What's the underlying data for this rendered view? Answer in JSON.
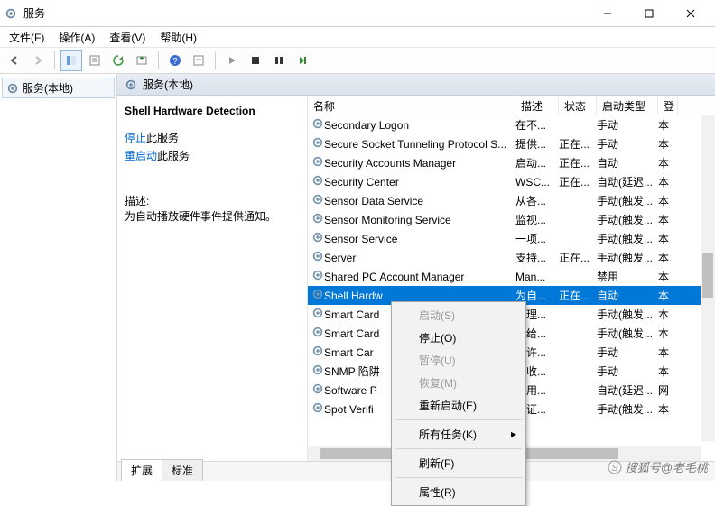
{
  "window": {
    "title": "服务"
  },
  "menu": {
    "file": "文件(F)",
    "action": "操作(A)",
    "view": "查看(V)",
    "help": "帮助(H)"
  },
  "tree": {
    "root": "服务(本地)"
  },
  "right_header": {
    "label": "服务(本地)"
  },
  "detail": {
    "title": "Shell Hardware Detection",
    "stop_link": "停止",
    "stop_suffix": "此服务",
    "restart_link": "重启动",
    "restart_suffix": "此服务",
    "desc_label": "描述:",
    "desc": "为自动播放硬件事件提供通知。"
  },
  "columns": {
    "name": "名称",
    "desc": "描述",
    "status": "状态",
    "startup": "启动类型",
    "logon": "登"
  },
  "services": [
    {
      "name": "Secondary Logon",
      "desc": "在不...",
      "status": "",
      "startup": "手动",
      "logon": "本"
    },
    {
      "name": "Secure Socket Tunneling Protocol S...",
      "desc": "提供...",
      "status": "正在...",
      "startup": "手动",
      "logon": "本"
    },
    {
      "name": "Security Accounts Manager",
      "desc": "启动...",
      "status": "正在...",
      "startup": "自动",
      "logon": "本"
    },
    {
      "name": "Security Center",
      "desc": "WSC...",
      "status": "正在...",
      "startup": "自动(延迟...",
      "logon": "本"
    },
    {
      "name": "Sensor Data Service",
      "desc": "从各...",
      "status": "",
      "startup": "手动(触发...",
      "logon": "本"
    },
    {
      "name": "Sensor Monitoring Service",
      "desc": "监视...",
      "status": "",
      "startup": "手动(触发...",
      "logon": "本"
    },
    {
      "name": "Sensor Service",
      "desc": "一项...",
      "status": "",
      "startup": "手动(触发...",
      "logon": "本"
    },
    {
      "name": "Server",
      "desc": "支持...",
      "status": "正在...",
      "startup": "手动(触发...",
      "logon": "本"
    },
    {
      "name": "Shared PC Account Manager",
      "desc": "Man...",
      "status": "",
      "startup": "禁用",
      "logon": "本"
    },
    {
      "name": "Shell Hardware Detection",
      "desc": "为自...",
      "status": "正在...",
      "startup": "自动",
      "logon": "本",
      "selected": true
    },
    {
      "name": "Smart Card",
      "desc": "管理...",
      "status": "",
      "startup": "手动(触发...",
      "logon": "本"
    },
    {
      "name": "Smart Card Device Enumeration",
      "desc": "为给...",
      "status": "",
      "startup": "手动(触发...",
      "logon": "本"
    },
    {
      "name": "Smart Card Removal Policy",
      "desc": "允许...",
      "status": "",
      "startup": "手动",
      "logon": "本"
    },
    {
      "name": "SNMP 陷阱",
      "desc": "接收...",
      "status": "",
      "startup": "手动",
      "logon": "本"
    },
    {
      "name": "Software Protection",
      "desc": "启用...",
      "status": "",
      "startup": "自动(延迟...",
      "logon": "网"
    },
    {
      "name": "Spot Verifier",
      "desc": "验证...",
      "status": "",
      "startup": "手动(触发...",
      "logon": "本"
    }
  ],
  "context_menu": {
    "start": "启动(S)",
    "stop": "停止(O)",
    "pause": "暂停(U)",
    "resume": "恢复(M)",
    "restart": "重新启动(E)",
    "all_tasks": "所有任务(K)",
    "refresh": "刷新(F)",
    "properties": "属性(R)"
  },
  "tabs": {
    "extended": "扩展",
    "standard": "标准"
  },
  "watermark": "搜狐号@老毛桃"
}
